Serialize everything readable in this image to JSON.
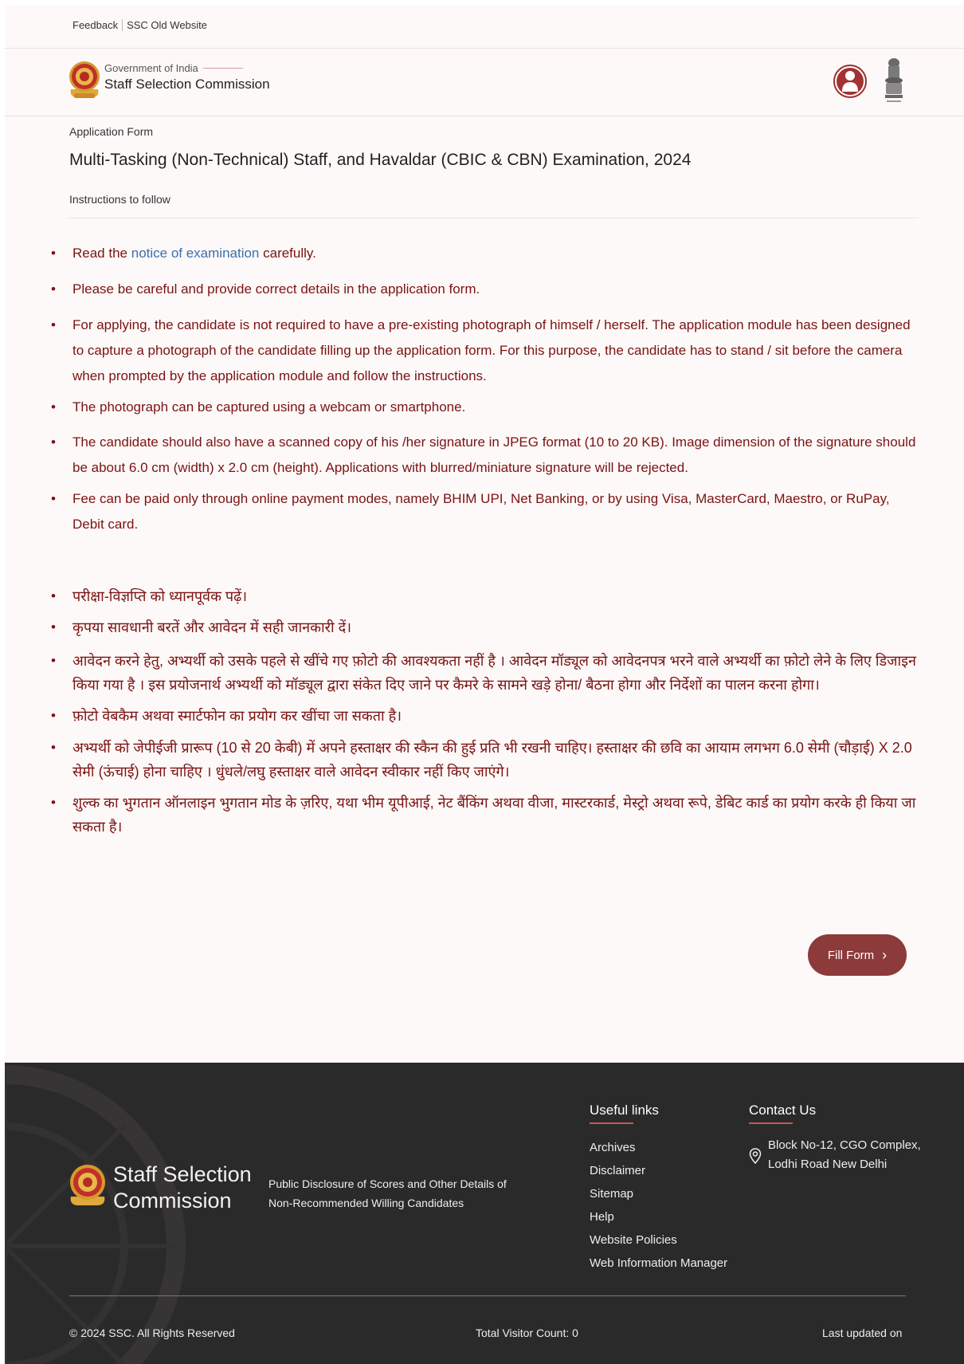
{
  "topbar": {
    "feedback": "Feedback",
    "old_site": "SSC Old Website"
  },
  "header": {
    "gov": "Government of India",
    "org": "Staff Selection Commission"
  },
  "page": {
    "breadcrumb": "Application Form",
    "title": "Multi-Tasking (Non-Technical) Staff, and Havaldar (CBIC & CBN) Examination, 2024",
    "subtitle": "Instructions to follow"
  },
  "instructions_en": {
    "item1": {
      "pre": "Read the ",
      "link": "notice of examination",
      "post": " carefully."
    },
    "item2": "Please be careful and provide correct details in the application form.",
    "item3": "For applying, the candidate is not required to have a pre-existing photograph of himself / herself. The application module has been designed to capture a photograph of the candidate filling up the application form. For this purpose, the candidate has to stand / sit before the camera when prompted by the application module and follow the instructions.",
    "item4": "The photograph can be captured using a webcam or smartphone.",
    "item5": "The candidate should also have a scanned copy of his /her signature in JPEG format (10 to 20 KB). Image dimension of the signature should be about 6.0 cm (width) x 2.0 cm (height). Applications with blurred/miniature signature will be rejected.",
    "item6": "Fee can be paid only through online payment modes, namely BHIM UPI, Net Banking, or by using Visa, MasterCard, Maestro, or RuPay, Debit card."
  },
  "instructions_hi": [
    "परीक्षा-विज्ञप्ति को ध्यानपूर्वक पढ़ें।",
    "कृपया सावधानी बरतें और आवेदन में सही जानकारी दें।",
    "आवेदन करने हेतु, अभ्यर्थी को उसके पहले से खींचे गए फ़ोटो की आवश्यकता नहीं है । आवेदन मॉड्यूल को आवेदनपत्र भरने वाले अभ्यर्थी का फ़ोटो लेने के लिए डिजाइन किया गया है । इस प्रयोजनार्थ अभ्यर्थी को मॉड्यूल द्वारा संकेत दिए जाने पर कैमरे के सामने खड़े होना/ बैठना होगा और निर्देशों का पालन करना होगा।",
    "फ़ोटो वेबकैम अथवा स्मार्टफोन का प्रयोग कर खींचा जा सकता है।",
    "अभ्यर्थी को जेपीईजी प्रारूप (10 से 20 केबी) में अपने हस्ताक्षर की स्कैन की हुई प्रति भी रखनी चाहिए। हस्ताक्षर की छवि का आयाम लगभग 6.0 सेमी (चौड़ाई) X 2.0 सेमी (ऊंचाई) होना चाहिए । धुंधले/लघु हस्ताक्षर वाले आवेदन स्वीकार नहीं किए जाएंगे।",
    "शुल्क का भुगतान ऑनलाइन भुगतान मोड के ज़रिए, यथा भीम यूपीआई, नेट बैंकिंग अथवा वीजा, मास्टरकार्ड, मेस्ट्रो अथवा रूपे, डेबिट कार्ड का प्रयोग करके ही किया जा सकता है।"
  ],
  "fill_form": {
    "label": "Fill Form",
    "chevron": "›"
  },
  "footer": {
    "org_line1": "Staff Selection",
    "org_line2": "Commission",
    "disclosure": "Public Disclosure of Scores and Other Details of Non-Recommended Willing Candidates",
    "useful_links_title": "Useful links",
    "useful_links": [
      "Archives",
      "Disclaimer",
      "Sitemap",
      "Help",
      "Website Policies",
      "Web Information Manager"
    ],
    "contact_title": "Contact Us",
    "address_line1": "Block No-12, CGO Complex,",
    "address_line2": "Lodhi Road New Delhi",
    "copyright": "© 2024 SSC. All Rights Reserved",
    "visitor_count": "Total Visitor Count: 0",
    "last_updated": "Last updated on"
  },
  "colors": {
    "brand": "#8c3a3a",
    "text_red": "#7b1212",
    "link": "#3b6fae",
    "footer_bg": "#2b2a2a"
  },
  "icons": {
    "user": "user-avatar-icon",
    "emblem": "national-emblem-icon",
    "location": "location-pin-icon"
  }
}
